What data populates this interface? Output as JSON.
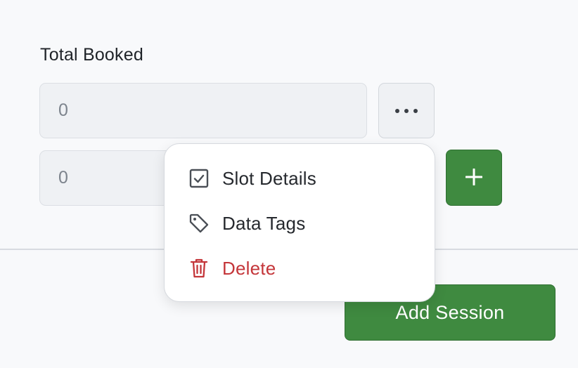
{
  "form": {
    "total_booked_label": "Total Booked",
    "field1_value": "0",
    "field2_value": "0"
  },
  "buttons": {
    "more_icon": "ellipsis-icon",
    "plus_icon": "plus-icon",
    "add_session_label": "Add Session"
  },
  "menu": {
    "items": [
      {
        "label": "Slot Details",
        "icon": "checkbox-icon"
      },
      {
        "label": "Data Tags",
        "icon": "tag-icon"
      },
      {
        "label": "Delete",
        "icon": "trash-icon"
      }
    ]
  },
  "colors": {
    "primary_green": "#3f8a40",
    "danger_red": "#c4363a",
    "field_bg": "#eff1f4"
  }
}
